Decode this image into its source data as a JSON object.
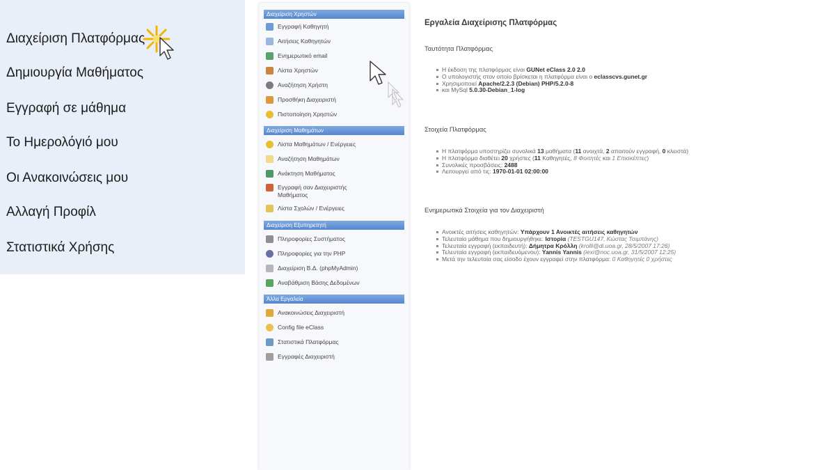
{
  "user_menu": {
    "items": [
      "Διαχείριση Πλατφόρμας",
      "Δημιουργία Μαθήματος",
      "Εγγραφή σε μάθημα",
      "Το Ημερολόγιό μου",
      "Οι Ανακοινώσεις μου",
      "Αλλαγή Προφίλ",
      "Στατιστικά Χρήσης"
    ]
  },
  "sidebar": {
    "sections": [
      {
        "header": "Διαχείριση Χρηστών",
        "items": [
          {
            "label": "Εγγραφή Καθηγητή",
            "icon": "user-add-icon"
          },
          {
            "label": "Αιτήσεις Καθηγητών",
            "icon": "user-requests-icon"
          },
          {
            "label": "Ενημερωτικό email",
            "icon": "email-icon"
          },
          {
            "label": "Λίστα Χρηστών",
            "icon": "users-list-icon"
          },
          {
            "label": "Αναζήτηση Χρήστη",
            "icon": "user-search-icon"
          },
          {
            "label": "Προσθήκη Διαχειριστή",
            "icon": "admin-add-icon"
          },
          {
            "label": "Πιστοποίηση Χρηστών",
            "icon": "key-icon"
          }
        ]
      },
      {
        "header": "Διαχείριση Μαθημάτων",
        "items": [
          {
            "label": "Λίστα Μαθημάτων / Ενέργειες",
            "icon": "courses-list-icon"
          },
          {
            "label": "Αναζήτηση Μαθημάτων",
            "icon": "course-search-icon"
          },
          {
            "label": "Ανάκτηση Μαθήματος",
            "icon": "course-restore-icon"
          },
          {
            "label": "Εγγραφή σαν Διαχειριστής Μαθήματος",
            "icon": "course-admin-icon"
          },
          {
            "label": "Λίστα Σχολών / Ενέργειες",
            "icon": "faculties-list-icon"
          }
        ]
      },
      {
        "header": "Διαχείριση Εξυπηρετητή",
        "items": [
          {
            "label": "Πληροφορίες Συστήματος",
            "icon": "system-info-icon"
          },
          {
            "label": "Πληροφορίες για την PHP",
            "icon": "php-info-icon"
          },
          {
            "label": "Διαχείριση Β.Δ. (phpMyAdmin)",
            "icon": "database-icon"
          },
          {
            "label": "Αναβάθμιση Βάσης Δεδομένων",
            "icon": "db-upgrade-icon"
          }
        ]
      },
      {
        "header": "Άλλα Εργαλεία",
        "items": [
          {
            "label": "Ανακοινώσεις Διαχειριστή",
            "icon": "announce-icon"
          },
          {
            "label": "Config file eClass",
            "icon": "config-icon"
          },
          {
            "label": "Στατιστικά Πλατφόρμας",
            "icon": "stats-icon"
          },
          {
            "label": "Εγγραφές Διαχειριστή",
            "icon": "admin-log-icon"
          }
        ]
      }
    ]
  },
  "main": {
    "title": "Εργαλεία Διαχείρισης Πλατφόρμας",
    "identity": {
      "title": "Ταυτότητα Πλατφόρμας",
      "items": [
        {
          "parts": [
            {
              "t": "Η έκδοση της πλατφόρμας είναι "
            },
            {
              "t": "GUNet eClass 2.0 2.0",
              "s": "b"
            }
          ]
        },
        {
          "parts": [
            {
              "t": "Ο υπολογιστής στον οποίο βρίσκεται η πλατφόρμα είναι ο "
            },
            {
              "t": "eclasscvs.gunet.gr",
              "s": "b"
            }
          ]
        },
        {
          "parts": [
            {
              "t": "Χρησιμοποιεί "
            },
            {
              "t": "Apache/2.2.3 (Debian) PHP/5.2.0-8",
              "s": "b"
            }
          ]
        },
        {
          "parts": [
            {
              "t": "και MySql "
            },
            {
              "t": "5.0.30-Debian_1-log",
              "s": "b"
            }
          ]
        }
      ]
    },
    "platform_data": {
      "title": "Στοιχεία Πλατφόρμας",
      "items": [
        {
          "parts": [
            {
              "t": "Η πλατφόρμα υποστηρίζει συνολικά "
            },
            {
              "t": "13",
              "s": "b"
            },
            {
              "t": " μαθήματα ("
            },
            {
              "t": "11",
              "s": "b"
            },
            {
              "t": " ανοιχτά, "
            },
            {
              "t": "2",
              "s": "b"
            },
            {
              "t": " απαιτούν εγγραφή, "
            },
            {
              "t": "0",
              "s": "b"
            },
            {
              "t": " κλειστά)"
            }
          ]
        },
        {
          "parts": [
            {
              "t": "Η πλατφόρμα διαθέτει "
            },
            {
              "t": "20",
              "s": "b"
            },
            {
              "t": " χρήστες ("
            },
            {
              "t": "11",
              "s": "b"
            },
            {
              "t": " Καθηγητές, "
            },
            {
              "t": "8 Φοιτητές",
              "s": "i"
            },
            {
              "t": " και "
            },
            {
              "t": "1 Επισκέπτες",
              "s": "i"
            },
            {
              "t": ")"
            }
          ]
        },
        {
          "parts": [
            {
              "t": "Συνολικές προσβάσεις: "
            },
            {
              "t": "2488",
              "s": "b"
            }
          ]
        },
        {
          "parts": [
            {
              "t": "Λειτουργεί από τις: "
            },
            {
              "t": "1970-01-01 02:00:00",
              "s": "b"
            }
          ]
        }
      ]
    },
    "admin_info": {
      "title": "Ενημερωτικά Στοιχεία για τον Διαχειριστή",
      "items": [
        {
          "parts": [
            {
              "t": "Ανοικτές αιτήσεις καθηγητών: "
            },
            {
              "t": "Υπάρχουν 1 Ανοικτές αιτήσεις καθηγητών",
              "s": "b"
            }
          ]
        },
        {
          "parts": [
            {
              "t": "Τελευταίο μάθημα που δημιουργήθηκε: "
            },
            {
              "t": "Ιστορία",
              "s": "b"
            },
            {
              "t": " (TESTGU147, Κώστας Τσιμπάνης)",
              "s": "i"
            }
          ]
        },
        {
          "parts": [
            {
              "t": "Τελευταία εγγραφή (εκπαιδευτή): "
            },
            {
              "t": "Δήμητρα Κρόλλη",
              "s": "b"
            },
            {
              "t": " (krolli@di.uoa.gr, 28/5/2007 17:26)",
              "s": "i"
            }
          ]
        },
        {
          "parts": [
            {
              "t": "Τελευταία εγγραφή (εκπαιδευόμενου): "
            },
            {
              "t": "Yannis Yannis",
              "s": "b"
            },
            {
              "t": " (iexi@noc.uoa.gr, 31/5/2007 12:25)",
              "s": "i"
            }
          ]
        },
        {
          "parts": [
            {
              "t": "Μετά την τελευταία σας είσοδο έχουν εγγραφεί στην πλατφόρμα: "
            },
            {
              "t": "0 Καθηγητές 0 χρήστες",
              "s": "i"
            }
          ]
        }
      ]
    }
  },
  "colors": {
    "menu_bg": "#e9eff8",
    "section_header": "#5f8fd6",
    "sidebar_bg": "#f7f8fb"
  }
}
